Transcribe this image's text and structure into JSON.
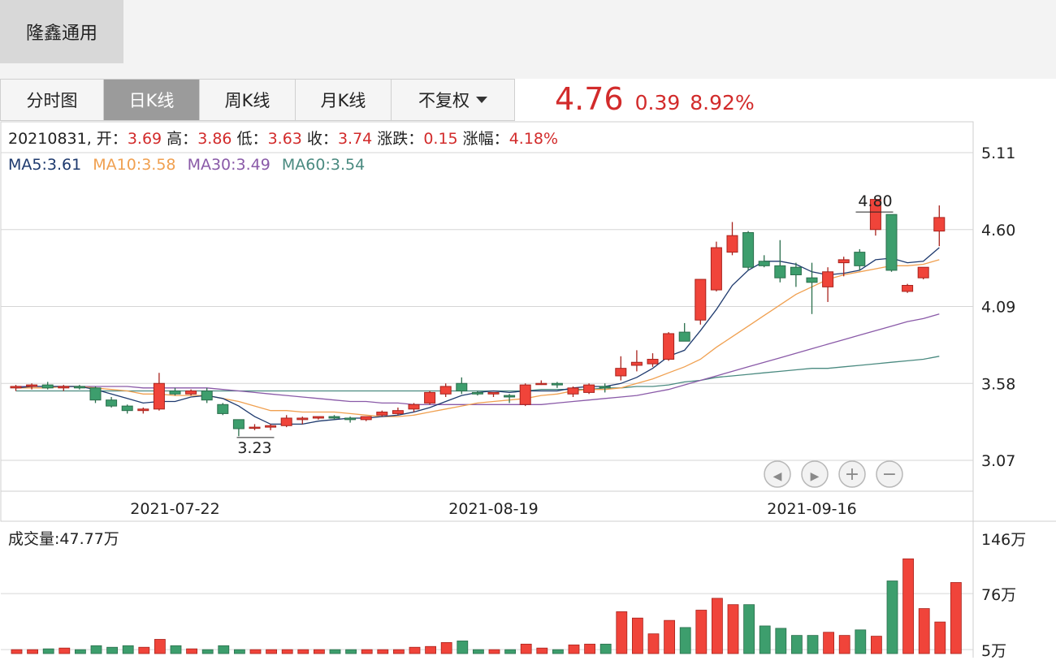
{
  "stock_name": "隆鑫通用",
  "tabs": [
    "分时图",
    "日K线",
    "周K线",
    "月K线",
    "不复权"
  ],
  "active_tab": 1,
  "quote": {
    "price": "4.76",
    "change": "0.39",
    "change_pct": "8.92%"
  },
  "info": {
    "date": "20210831,",
    "open_label": "开：",
    "open": "3.69",
    "high_label": "高：",
    "high": "3.86",
    "low_label": "低：",
    "low": "3.63",
    "close_label": "收：",
    "close": "3.74",
    "change_label": "涨跌：",
    "change": "0.15",
    "pct_label": "涨幅：",
    "pct": "4.18%"
  },
  "ma_labels": {
    "ma5": "MA5:3.61",
    "ma10": "MA10:3.58",
    "ma30": "MA30:3.49",
    "ma60": "MA60:3.54"
  },
  "colors": {
    "up": "#f0443a",
    "down": "#3d9e6d",
    "ma5": "#1e3a6e",
    "ma10": "#f0a050",
    "ma30": "#8a5aa8",
    "ma60": "#4a8a80"
  },
  "volume_label": "成交量:47.77万",
  "chart_data": {
    "type": "candlestick",
    "y_ticks": [
      "5.11",
      "4.60",
      "4.09",
      "3.58",
      "3.07"
    ],
    "ylim": [
      3.07,
      5.11
    ],
    "x_ticks": [
      {
        "index": 10,
        "label": "2021-07-22"
      },
      {
        "index": 30,
        "label": "2021-08-19"
      },
      {
        "index": 50,
        "label": "2021-09-16"
      }
    ],
    "max_label": {
      "index": 55,
      "label": "4.80"
    },
    "min_label": {
      "index": 15,
      "label": "3.23"
    },
    "candles": [
      [
        3.55,
        3.57,
        3.53,
        3.56
      ],
      [
        3.56,
        3.58,
        3.54,
        3.57
      ],
      [
        3.57,
        3.59,
        3.54,
        3.55
      ],
      [
        3.55,
        3.57,
        3.53,
        3.56
      ],
      [
        3.56,
        3.57,
        3.54,
        3.55
      ],
      [
        3.55,
        3.56,
        3.45,
        3.47
      ],
      [
        3.47,
        3.49,
        3.42,
        3.43
      ],
      [
        3.43,
        3.44,
        3.38,
        3.4
      ],
      [
        3.4,
        3.42,
        3.38,
        3.41
      ],
      [
        3.41,
        3.65,
        3.4,
        3.58
      ],
      [
        3.53,
        3.55,
        3.5,
        3.51
      ],
      [
        3.51,
        3.54,
        3.5,
        3.53
      ],
      [
        3.53,
        3.55,
        3.45,
        3.47
      ],
      [
        3.44,
        3.45,
        3.37,
        3.38
      ],
      [
        3.34,
        3.34,
        3.23,
        3.28
      ],
      [
        3.29,
        3.31,
        3.27,
        3.29
      ],
      [
        3.29,
        3.31,
        3.27,
        3.3
      ],
      [
        3.3,
        3.37,
        3.29,
        3.35
      ],
      [
        3.34,
        3.36,
        3.31,
        3.35
      ],
      [
        3.35,
        3.36,
        3.34,
        3.36
      ],
      [
        3.36,
        3.37,
        3.34,
        3.35
      ],
      [
        3.35,
        3.36,
        3.32,
        3.34
      ],
      [
        3.34,
        3.36,
        3.33,
        3.36
      ],
      [
        3.37,
        3.4,
        3.36,
        3.39
      ],
      [
        3.38,
        3.42,
        3.37,
        3.4
      ],
      [
        3.41,
        3.45,
        3.39,
        3.44
      ],
      [
        3.45,
        3.53,
        3.44,
        3.52
      ],
      [
        3.51,
        3.58,
        3.49,
        3.56
      ],
      [
        3.58,
        3.62,
        3.51,
        3.53
      ],
      [
        3.52,
        3.53,
        3.5,
        3.51
      ],
      [
        3.51,
        3.52,
        3.49,
        3.52
      ],
      [
        3.5,
        3.51,
        3.45,
        3.49
      ],
      [
        3.44,
        3.58,
        3.43,
        3.57
      ],
      [
        3.58,
        3.6,
        3.57,
        3.58
      ],
      [
        3.58,
        3.59,
        3.55,
        3.57
      ],
      [
        3.51,
        3.56,
        3.49,
        3.55
      ],
      [
        3.52,
        3.58,
        3.51,
        3.57
      ],
      [
        3.56,
        3.58,
        3.52,
        3.55
      ],
      [
        3.63,
        3.76,
        3.6,
        3.68
      ],
      [
        3.7,
        3.8,
        3.66,
        3.72
      ],
      [
        3.71,
        3.78,
        3.69,
        3.74
      ],
      [
        3.74,
        3.92,
        3.73,
        3.91
      ],
      [
        3.92,
        3.98,
        3.86,
        3.86
      ],
      [
        4.0,
        4.19,
        3.97,
        4.27
      ],
      [
        4.2,
        4.52,
        4.19,
        4.48
      ],
      [
        4.45,
        4.65,
        4.43,
        4.56
      ],
      [
        4.58,
        4.59,
        4.33,
        4.35
      ],
      [
        4.39,
        4.43,
        4.35,
        4.36
      ],
      [
        4.36,
        4.53,
        4.25,
        4.28
      ],
      [
        4.35,
        4.38,
        4.22,
        4.3
      ],
      [
        4.28,
        4.38,
        4.04,
        4.25
      ],
      [
        4.22,
        4.35,
        4.12,
        4.32
      ],
      [
        4.38,
        4.42,
        4.29,
        4.4
      ],
      [
        4.45,
        4.47,
        4.33,
        4.36
      ],
      [
        4.6,
        4.8,
        4.56,
        4.8
      ],
      [
        4.7,
        4.7,
        4.32,
        4.33
      ],
      [
        4.19,
        4.24,
        4.18,
        4.23
      ],
      [
        4.28,
        4.35,
        4.27,
        4.35
      ],
      [
        4.59,
        4.76,
        4.49,
        4.68
      ]
    ],
    "ma5": [
      3.55,
      3.56,
      3.56,
      3.56,
      3.56,
      3.54,
      3.51,
      3.48,
      3.45,
      3.46,
      3.46,
      3.49,
      3.5,
      3.48,
      3.43,
      3.36,
      3.31,
      3.31,
      3.31,
      3.33,
      3.34,
      3.35,
      3.35,
      3.36,
      3.37,
      3.39,
      3.42,
      3.46,
      3.5,
      3.52,
      3.53,
      3.52,
      3.53,
      3.53,
      3.53,
      3.55,
      3.56,
      3.56,
      3.58,
      3.62,
      3.68,
      3.76,
      3.8,
      3.93,
      4.07,
      4.23,
      4.33,
      4.39,
      4.39,
      4.37,
      4.32,
      4.3,
      4.31,
      4.33,
      4.4,
      4.41,
      4.38,
      4.39,
      4.48
    ],
    "ma10": [
      3.55,
      3.55,
      3.55,
      3.56,
      3.56,
      3.55,
      3.54,
      3.53,
      3.51,
      3.51,
      3.5,
      3.5,
      3.5,
      3.48,
      3.46,
      3.43,
      3.4,
      3.4,
      3.39,
      3.39,
      3.39,
      3.38,
      3.37,
      3.36,
      3.36,
      3.37,
      3.39,
      3.41,
      3.43,
      3.45,
      3.46,
      3.47,
      3.48,
      3.5,
      3.51,
      3.53,
      3.54,
      3.54,
      3.55,
      3.58,
      3.61,
      3.65,
      3.69,
      3.74,
      3.82,
      3.89,
      3.96,
      4.03,
      4.1,
      4.17,
      4.22,
      4.27,
      4.3,
      4.32,
      4.34,
      4.36,
      4.36,
      4.37,
      4.4
    ],
    "ma30": [
      3.56,
      3.56,
      3.56,
      3.56,
      3.56,
      3.56,
      3.56,
      3.56,
      3.55,
      3.55,
      3.55,
      3.55,
      3.55,
      3.54,
      3.53,
      3.52,
      3.51,
      3.5,
      3.49,
      3.48,
      3.47,
      3.46,
      3.46,
      3.45,
      3.45,
      3.44,
      3.44,
      3.44,
      3.44,
      3.44,
      3.44,
      3.44,
      3.44,
      3.44,
      3.45,
      3.46,
      3.47,
      3.48,
      3.49,
      3.5,
      3.52,
      3.54,
      3.57,
      3.6,
      3.63,
      3.66,
      3.69,
      3.72,
      3.75,
      3.78,
      3.81,
      3.84,
      3.87,
      3.9,
      3.93,
      3.96,
      3.99,
      4.01,
      4.04
    ],
    "ma60": [
      3.53,
      3.53,
      3.53,
      3.53,
      3.53,
      3.53,
      3.53,
      3.53,
      3.53,
      3.53,
      3.53,
      3.53,
      3.53,
      3.53,
      3.53,
      3.53,
      3.53,
      3.53,
      3.53,
      3.53,
      3.53,
      3.53,
      3.53,
      3.53,
      3.53,
      3.53,
      3.53,
      3.53,
      3.53,
      3.53,
      3.53,
      3.53,
      3.53,
      3.54,
      3.54,
      3.54,
      3.54,
      3.55,
      3.55,
      3.56,
      3.56,
      3.57,
      3.59,
      3.6,
      3.62,
      3.63,
      3.64,
      3.65,
      3.66,
      3.67,
      3.68,
      3.68,
      3.69,
      3.7,
      3.71,
      3.72,
      3.73,
      3.74,
      3.76
    ],
    "vol_ticks": [
      "146万",
      "76万",
      "5万"
    ],
    "vol_max": 146,
    "volumes": [
      5,
      5,
      6,
      7,
      5,
      10,
      8,
      10,
      8,
      18,
      10,
      6,
      5,
      10,
      5,
      5,
      5,
      5,
      5,
      5,
      5,
      5,
      5,
      5,
      5,
      8,
      9,
      14,
      16,
      5,
      5,
      5,
      12,
      7,
      5,
      11,
      12,
      12,
      53,
      45,
      25,
      42,
      33,
      55,
      70,
      62,
      62,
      35,
      32,
      23,
      23,
      27,
      23,
      30,
      22,
      92,
      120,
      57,
      40,
      90
    ]
  }
}
